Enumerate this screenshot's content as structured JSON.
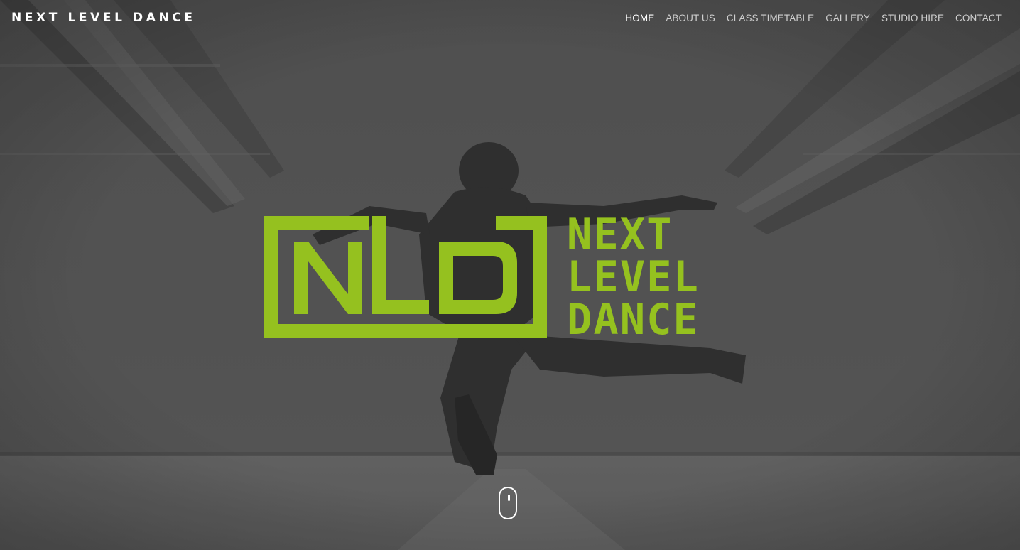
{
  "header": {
    "brand": "NEXT LEVEL DANCE"
  },
  "nav": {
    "items": [
      {
        "label": "HOME",
        "active": true
      },
      {
        "label": "ABOUT US",
        "active": false
      },
      {
        "label": "CLASS TIMETABLE",
        "active": false
      },
      {
        "label": "GALLERY",
        "active": false
      },
      {
        "label": "STUDIO HIRE",
        "active": false
      },
      {
        "label": "CONTACT",
        "active": false
      }
    ]
  },
  "hero": {
    "logo": {
      "monogram": "NLD",
      "words": [
        "NEXT",
        "LEVEL",
        "DANCE"
      ],
      "color": "#95c11f"
    },
    "background_icon": "dancer-photo"
  },
  "scroll_indicator": {
    "icon": "mouse-scroll-icon"
  },
  "colors": {
    "accent": "#95c11f",
    "nav_text": "#cfcfcf",
    "nav_active": "#ffffff"
  }
}
